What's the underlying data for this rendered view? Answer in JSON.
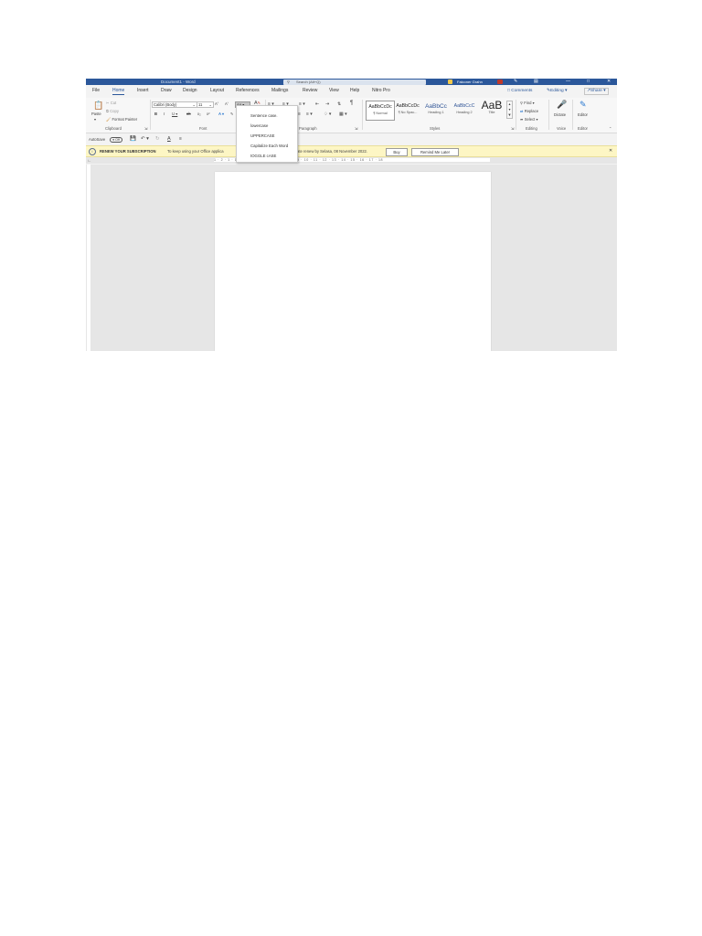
{
  "titlebar": {
    "doc_title": "Document1 - Word",
    "search": "Search (Alt+Q)",
    "user": "Falconer Grahn",
    "controls": [
      "—",
      "□",
      "✕"
    ]
  },
  "tabs": [
    "File",
    "Home",
    "Insert",
    "Draw",
    "Design",
    "Layout",
    "References",
    "Mailings",
    "Review",
    "View",
    "Help",
    "Nitro Pro"
  ],
  "active_tab": "Home",
  "ribbon_buttons": {
    "comments": "Comments",
    "editing": "Editing",
    "share": "Share"
  },
  "clipboard": {
    "paste": "Paste",
    "cut": "Cut",
    "copy": "Copy",
    "format_painter": "Format Painter",
    "label": "Clipboard"
  },
  "font": {
    "name": "Calibri (Body)",
    "size": "11",
    "change_case": "Aa",
    "label": "Font"
  },
  "paragraph": {
    "label": "Paragraph"
  },
  "styles": {
    "items": [
      {
        "preview": "AaBbCcDc",
        "caption": "¶ Normal"
      },
      {
        "preview": "AaBbCcDc",
        "caption": "¶ No Spac..."
      },
      {
        "preview": "AaBbCc",
        "caption": "Heading 1"
      },
      {
        "preview": "AaBbCcC",
        "caption": "Heading 2"
      },
      {
        "preview": "AaB",
        "caption": "Title"
      }
    ],
    "label": "Styles"
  },
  "editing": {
    "find": "Find",
    "replace": "Replace",
    "select": "Select",
    "label": "Editing"
  },
  "voice": {
    "dictate": "Dictate",
    "label": "Voice"
  },
  "editor": {
    "editor": "Editor",
    "label": "Editor"
  },
  "qat": {
    "autosave": "AutoSave",
    "toggle": "Off"
  },
  "banner": {
    "title": "RENEW YOUR SUBSCRIPTION",
    "message_start": "To keep using your Office applica",
    "message_end": "ate renew by Selasa, 08 November 2022.",
    "buy": "Buy",
    "remind": "Remind Me Later"
  },
  "ruler": {
    "ticks": "1 · 2 · 1 · 1 · 1 · 2 · 3 · 4 · 5 · 6 · 7 · 8 · 9 · 10 · 11 · 12 · 13 · 14 · 15 · 16 · 17 · 18"
  },
  "change_case_menu": [
    "Sentence case.",
    "lowercase",
    "UPPERCASE",
    "Capitalize Each Word",
    "tOGGLE cASE"
  ]
}
